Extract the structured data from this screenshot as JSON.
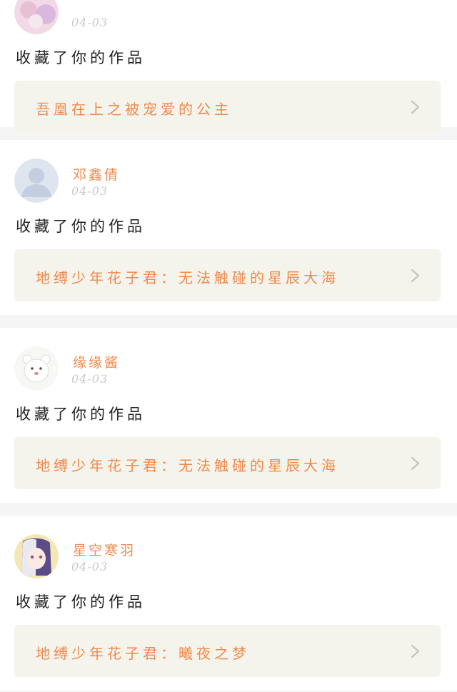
{
  "feed": {
    "items": [
      {
        "username": "",
        "date": "04-03",
        "action": "收藏了你的作品",
        "work_title": "吾凰在上之被宠爱的公主",
        "avatar_icon": "anime-girl-avatar-icon"
      },
      {
        "username": "邓鑫倩",
        "date": "04-03",
        "action": "收藏了你的作品",
        "work_title": "地缚少年花子君：无法触碰的星辰大海",
        "avatar_icon": "default-user-avatar-icon"
      },
      {
        "username": "缘缘酱",
        "date": "04-03",
        "action": "收藏了你的作品",
        "work_title": "地缚少年花子君：无法触碰的星辰大海",
        "avatar_icon": "bear-avatar-icon"
      },
      {
        "username": "星空寒羽",
        "date": "04-03",
        "action": "收藏了你的作品",
        "work_title": "地缚少年花子君：曦夜之梦",
        "avatar_icon": "anime-girl-avatar-icon"
      }
    ]
  },
  "colors": {
    "accent": "#f08a4b",
    "box_bg": "#f4f3ec",
    "divider": "#f5f5f5",
    "date_text": "#c9c9c9"
  }
}
